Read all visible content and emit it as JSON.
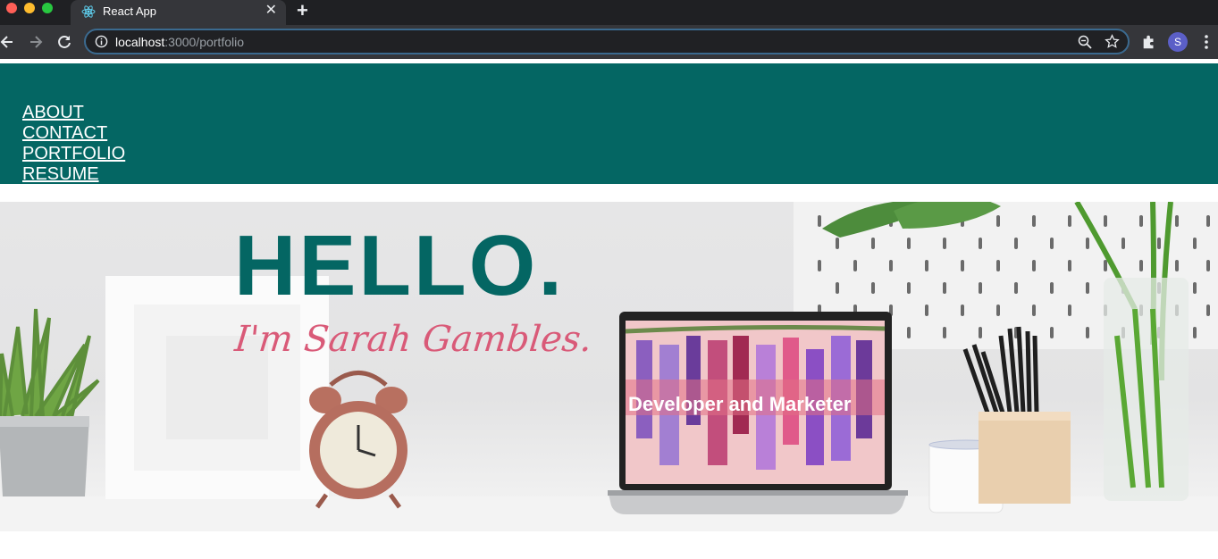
{
  "browser": {
    "tab_title": "React App",
    "url_host": "localhost",
    "url_path": ":3000/portfolio",
    "profile_initial": "S"
  },
  "nav": {
    "items": [
      {
        "label": "ABOUT"
      },
      {
        "label": "CONTACT"
      },
      {
        "label": "PORTFOLIO"
      },
      {
        "label": "RESUME"
      }
    ]
  },
  "hero": {
    "heading": "HELLO.",
    "tagline": "I'm Sarah Gambles.",
    "laptop_caption": "Developer and Marketer"
  },
  "colors": {
    "header_bg": "#046663",
    "heading": "#046663",
    "tagline": "#d95a78"
  }
}
